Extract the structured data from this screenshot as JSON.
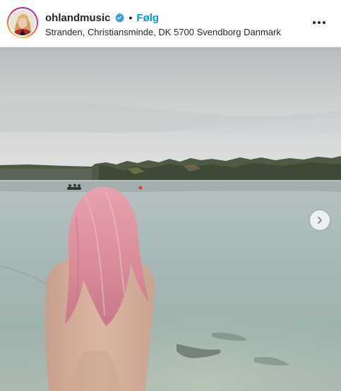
{
  "post": {
    "username": "ohlandmusic",
    "verified": true,
    "separator": "•",
    "follow_label": "Følg",
    "location": "Stranden, Christiansminde, DK 5700 Svendborg Danmark"
  },
  "icons": {
    "verified": "verified-badge-icon",
    "more": "more-options-icon",
    "next": "chevron-right-icon"
  },
  "colors": {
    "follow": "#0095f6",
    "verified": "#3897f0",
    "text": "#262626"
  }
}
